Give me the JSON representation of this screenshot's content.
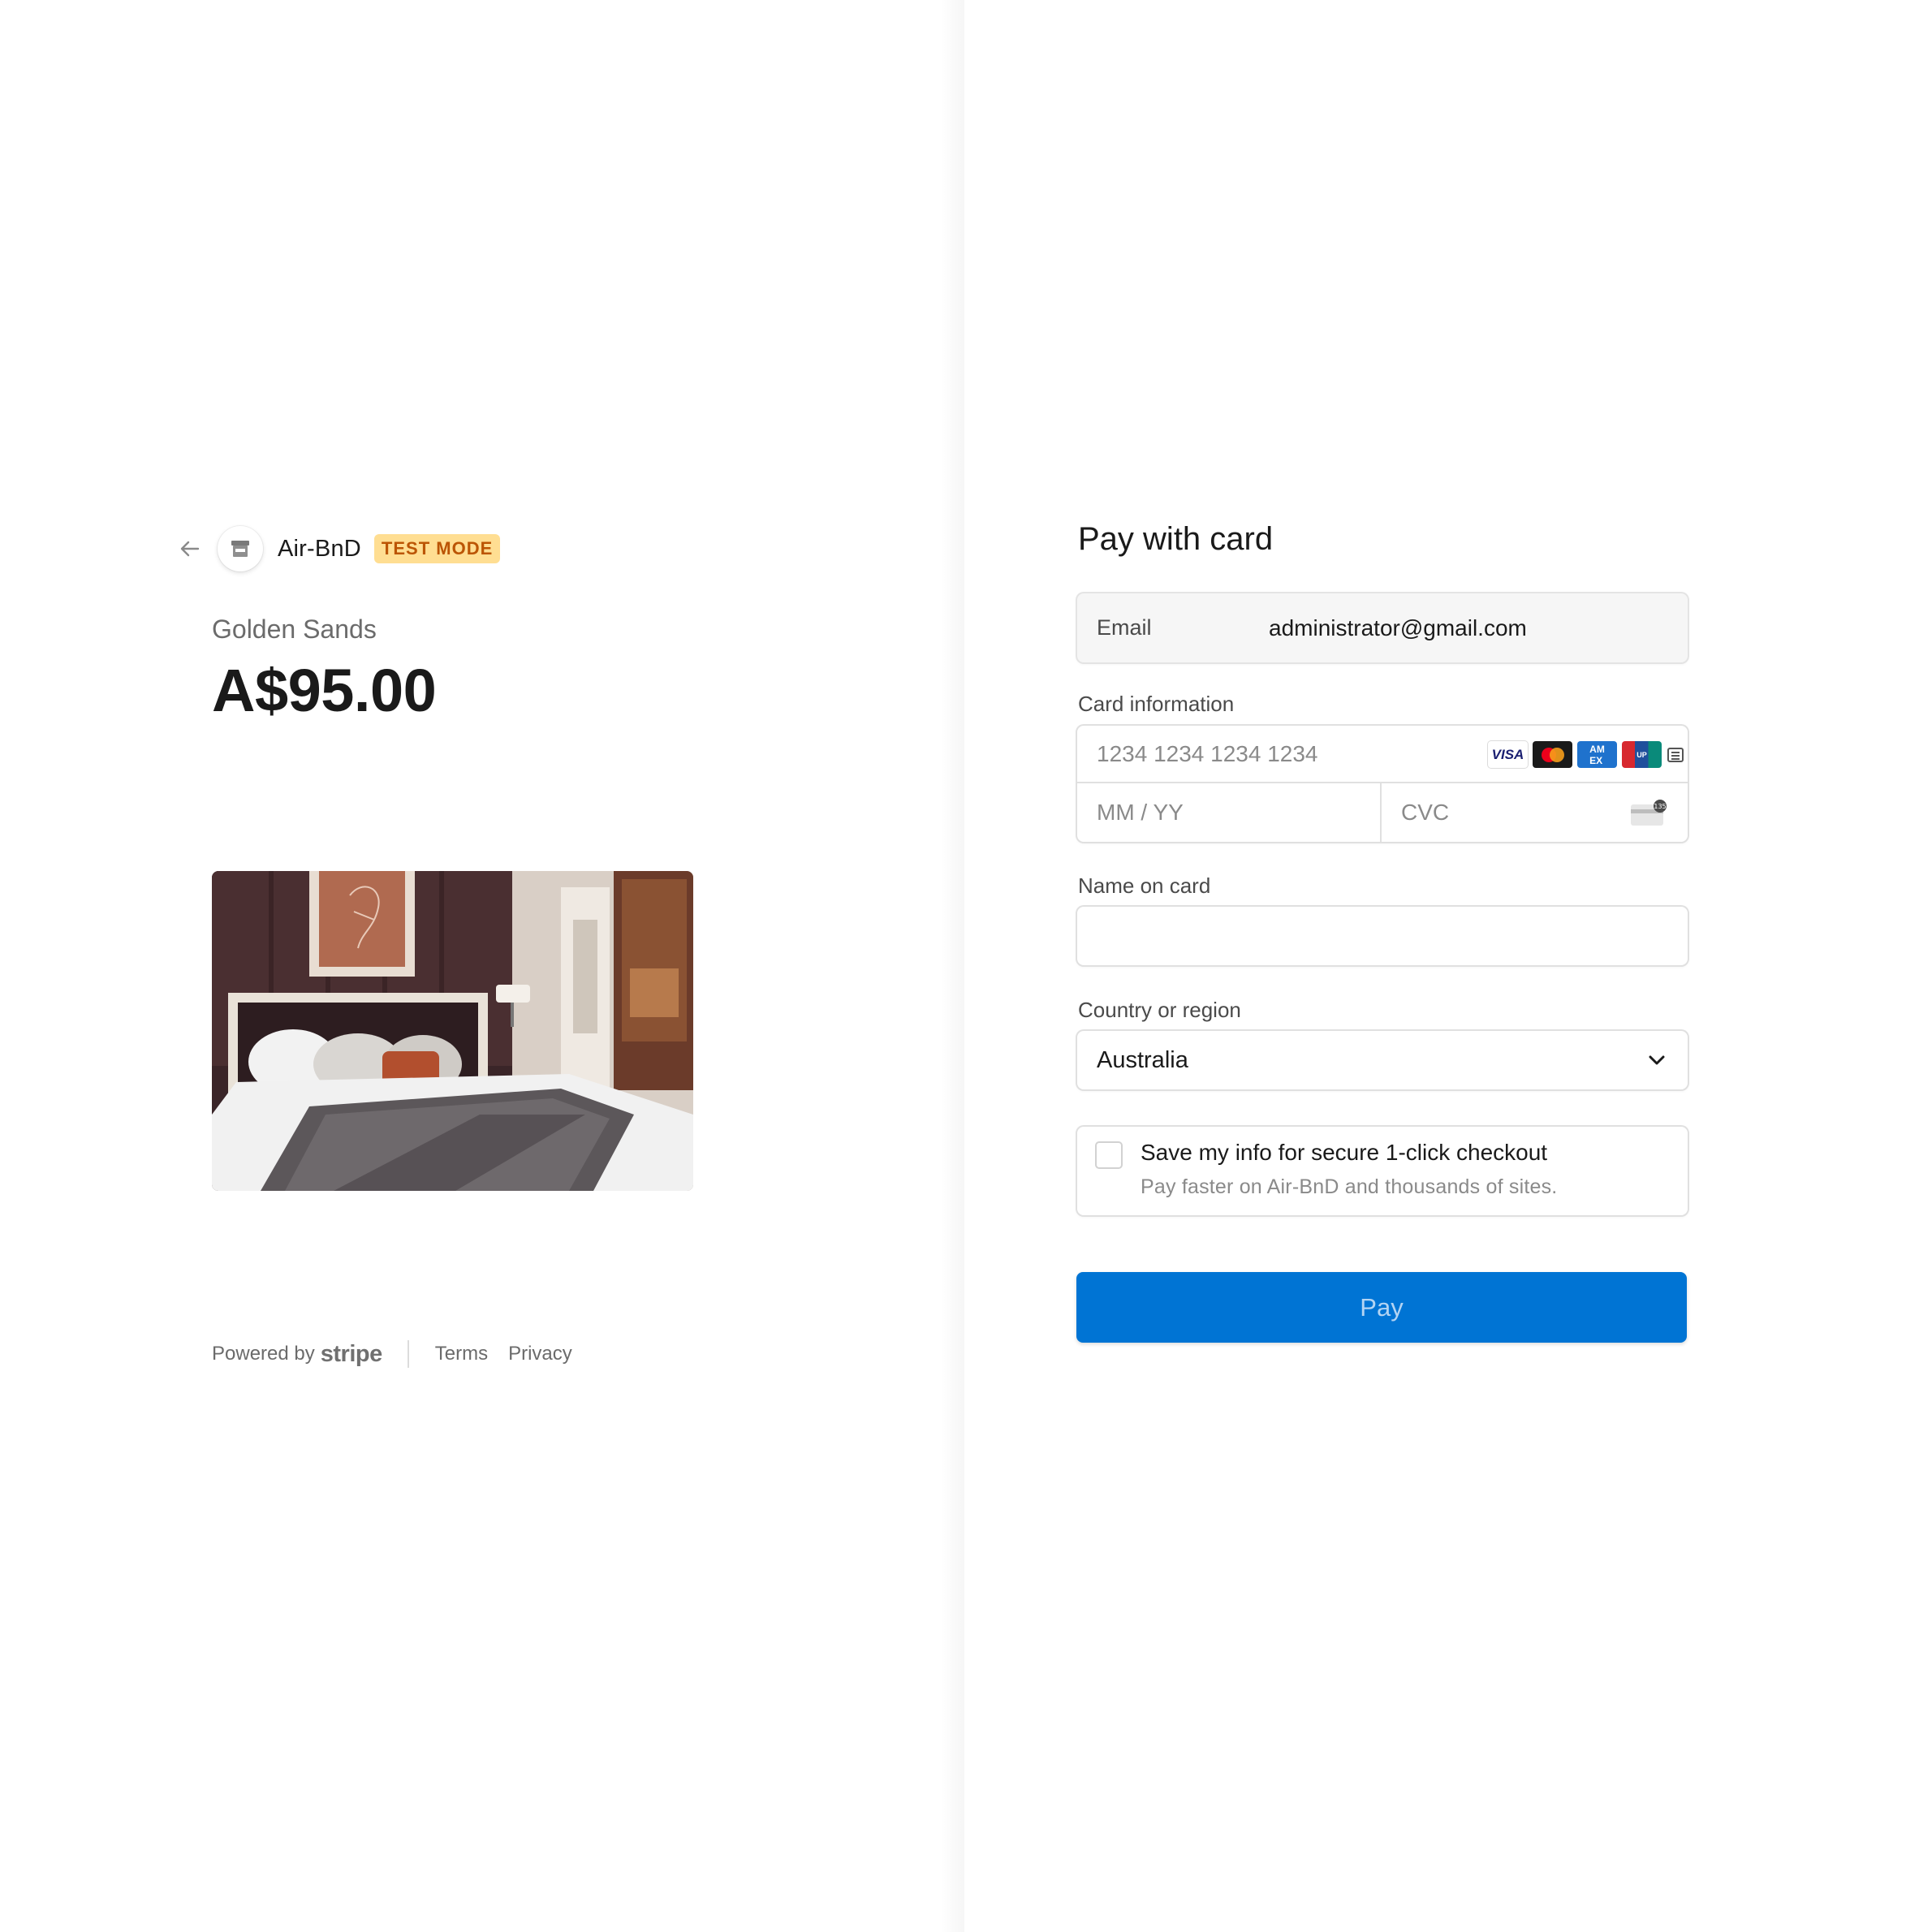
{
  "colors": {
    "accent": "#0074d4",
    "badge_bg": "#ffde92",
    "badge_text": "#bb5504"
  },
  "header": {
    "back_icon": "arrow-left-icon",
    "store_icon": "storefront-icon",
    "merchant_name": "Air-BnD",
    "badge": "TEST MODE"
  },
  "product": {
    "name": "Golden Sands",
    "price": "A$95.00",
    "image": "hotel-bedroom-photo"
  },
  "footer": {
    "powered_by": "Powered by",
    "brand": "stripe",
    "links": [
      "Terms",
      "Privacy"
    ]
  },
  "form": {
    "title": "Pay with card",
    "email": {
      "label": "Email",
      "value": "administrator@gmail.com"
    },
    "card": {
      "label": "Card information",
      "number_placeholder": "1234 1234 1234 1234",
      "expiry_placeholder": "MM / YY",
      "cvc_placeholder": "CVC",
      "brands": [
        "VISA",
        "mastercard",
        "amex",
        "unionpay",
        "more"
      ]
    },
    "name": {
      "label": "Name on card",
      "value": ""
    },
    "country": {
      "label": "Country or region",
      "value": "Australia"
    },
    "save": {
      "title": "Save my info for secure 1-click checkout",
      "subtitle": "Pay faster on Air-BnD and thousands of sites."
    },
    "pay_label": "Pay"
  }
}
